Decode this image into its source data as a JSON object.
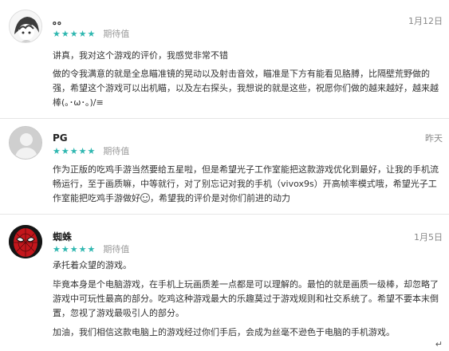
{
  "reviews": [
    {
      "user": "。。",
      "stars": "★★★★★",
      "rating_label": "期待值",
      "date": "1月12日",
      "paragraphs": [
        "讲真，我对这个游戏的评价，我感觉非常不错",
        "做的令我满意的就是全息瞄准镜的晃动以及射击音效，瞄准是下方有能看见胳膊，比隔壁荒野做的强，希望这个游戏可以出机瞄，以及左右探头，我想说的就是这些，祝愿你们做的越来越好，越来越棒(｡･ω･｡)/≡"
      ]
    },
    {
      "user": "PG",
      "stars": "★★★★★",
      "rating_label": "期待值",
      "date": "昨天",
      "paragraph_before_emoji": "作为正版的吃鸡手游当然要给五星啦，但是希望光子工作室能把这款游戏优化到最好，让我的手机流畅运行，至于画质嘛，中等就行，对了别忘记对我的手机（vivox9s）开高帧率模式哦，希望光子工作室能把吃鸡手游做好",
      "paragraph_after_emoji": "，希望我的评价是对你们前进的动力"
    },
    {
      "user": "蜘蛛",
      "stars": "★★★★★",
      "rating_label": "期待值",
      "date": "1月5日",
      "paragraphs": [
        "承托着众望的游戏。",
        "毕竟本身是个电脑游戏，在手机上玩画质差一点都是可以理解的。最怕的就是画质一级棒，却忽略了游戏中可玩性最高的部分。吃鸡这种游戏最大的乐趣莫过于游戏规则和社交系统了。希望不要本末倒置，忽视了游戏最吸引人的部分。",
        "加油，我们相信这款电脑上的游戏经过你们手后，会成为丝毫不逊色于电脑的手机游戏。"
      ]
    }
  ],
  "footer_mark": "↵",
  "colors": {
    "star": "#2fb7b0",
    "muted": "#9a9a9a",
    "text": "#333333"
  }
}
